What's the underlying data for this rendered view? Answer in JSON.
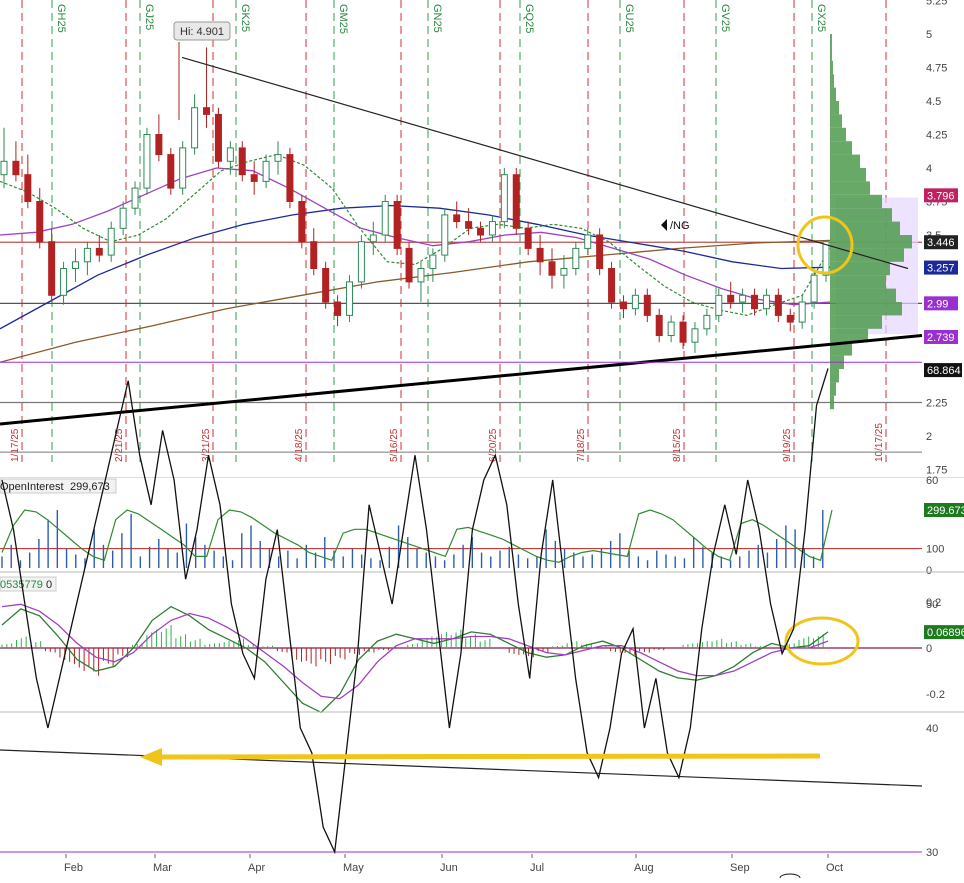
{
  "chart_data": [
    {
      "type": "candlestick",
      "symbol": "/NG",
      "hi_label": "Hi: 4.901",
      "y_ticks": [
        "5.25",
        "5",
        "4.75",
        "4.5",
        "4.25",
        "4",
        "3.75",
        "3.5",
        "3.25",
        "3",
        "2.75",
        "2.5",
        "2.25",
        "2",
        "1.75"
      ],
      "y_tick_values": [
        5.25,
        5,
        4.75,
        4.5,
        4.25,
        4,
        3.75,
        3.5,
        3.25,
        3,
        2.75,
        2.5,
        2.25,
        2,
        1.75
      ],
      "ylim": [
        1.75,
        5.25
      ],
      "price_badges": [
        {
          "label": "3.796",
          "value": 3.796,
          "color": "#c02060"
        },
        {
          "label": "3.446",
          "value": 3.446,
          "color": "#222222"
        },
        {
          "label": "3.257",
          "value": 3.257,
          "color": "#1a2a9a"
        },
        {
          "label": "2.99",
          "value": 2.99,
          "color": "#9b30d0"
        },
        {
          "label": "2.739",
          "value": 2.739,
          "color": "#9b30d0"
        }
      ],
      "contract_labels": [
        "GH25",
        "GJ25",
        "GK25",
        "GM25",
        "GN25",
        "GQ25",
        "GU25",
        "GV25",
        "GX25"
      ],
      "expiry_labels": [
        "1/17/25",
        "2/21/25",
        "3/21/25",
        "4/18/25",
        "5/16/25",
        "6/20/25",
        "7/18/25",
        "8/15/25",
        "9/19/25",
        "10/17/25"
      ],
      "candles": [
        [
          3.95,
          4.3,
          3.85,
          4.05
        ],
        [
          4.05,
          4.2,
          3.9,
          3.95
        ],
        [
          3.95,
          4.1,
          3.7,
          3.75
        ],
        [
          3.75,
          3.85,
          3.4,
          3.45
        ],
        [
          3.45,
          3.55,
          3.0,
          3.05
        ],
        [
          3.05,
          3.3,
          2.98,
          3.25
        ],
        [
          3.25,
          3.4,
          3.15,
          3.3
        ],
        [
          3.3,
          3.45,
          3.2,
          3.4
        ],
        [
          3.4,
          3.5,
          3.3,
          3.35
        ],
        [
          3.35,
          3.6,
          3.3,
          3.55
        ],
        [
          3.55,
          3.75,
          3.5,
          3.7
        ],
        [
          3.7,
          3.9,
          3.65,
          3.85
        ],
        [
          3.85,
          4.3,
          3.8,
          4.25
        ],
        [
          4.25,
          4.4,
          4.05,
          4.1
        ],
        [
          4.1,
          4.15,
          3.8,
          3.85
        ],
        [
          3.85,
          4.2,
          3.8,
          4.15
        ],
        [
          4.15,
          4.55,
          4.1,
          4.45
        ],
        [
          4.45,
          4.9,
          4.3,
          4.4
        ],
        [
          4.4,
          4.45,
          4.0,
          4.05
        ],
        [
          4.05,
          4.2,
          3.95,
          4.15
        ],
        [
          4.15,
          4.2,
          3.9,
          3.95
        ],
        [
          3.95,
          4.05,
          3.8,
          3.9
        ],
        [
          3.9,
          4.1,
          3.85,
          4.05
        ],
        [
          4.05,
          4.2,
          3.95,
          4.1
        ],
        [
          4.1,
          4.15,
          3.7,
          3.75
        ],
        [
          3.75,
          3.8,
          3.4,
          3.45
        ],
        [
          3.45,
          3.55,
          3.2,
          3.25
        ],
        [
          3.25,
          3.3,
          2.95,
          3.0
        ],
        [
          3.0,
          3.05,
          2.82,
          2.9
        ],
        [
          2.9,
          3.2,
          2.85,
          3.15
        ],
        [
          3.15,
          3.5,
          3.1,
          3.45
        ],
        [
          3.45,
          3.6,
          3.35,
          3.5
        ],
        [
          3.5,
          3.8,
          3.45,
          3.75
        ],
        [
          3.75,
          3.8,
          3.35,
          3.4
        ],
        [
          3.4,
          3.45,
          3.1,
          3.15
        ],
        [
          3.15,
          3.3,
          3.0,
          3.25
        ],
        [
          3.25,
          3.4,
          3.15,
          3.35
        ],
        [
          3.35,
          3.7,
          3.3,
          3.65
        ],
        [
          3.65,
          3.75,
          3.55,
          3.6
        ],
        [
          3.6,
          3.7,
          3.5,
          3.55
        ],
        [
          3.55,
          3.6,
          3.45,
          3.5
        ],
        [
          3.5,
          3.65,
          3.45,
          3.6
        ],
        [
          3.6,
          4.0,
          3.55,
          3.95
        ],
        [
          3.95,
          4.0,
          3.5,
          3.55
        ],
        [
          3.55,
          3.6,
          3.35,
          3.4
        ],
        [
          3.4,
          3.5,
          3.2,
          3.3
        ],
        [
          3.3,
          3.4,
          3.1,
          3.2
        ],
        [
          3.2,
          3.35,
          3.1,
          3.25
        ],
        [
          3.25,
          3.45,
          3.2,
          3.4
        ],
        [
          3.4,
          3.55,
          3.35,
          3.5
        ],
        [
          3.5,
          3.55,
          3.2,
          3.25
        ],
        [
          3.25,
          3.3,
          2.95,
          3.0
        ],
        [
          3.0,
          3.05,
          2.88,
          2.95
        ],
        [
          2.95,
          3.1,
          2.9,
          3.05
        ],
        [
          3.05,
          3.1,
          2.85,
          2.9
        ],
        [
          2.9,
          2.95,
          2.7,
          2.75
        ],
        [
          2.75,
          2.9,
          2.7,
          2.85
        ],
        [
          2.85,
          2.9,
          2.65,
          2.7
        ],
        [
          2.7,
          2.85,
          2.62,
          2.8
        ],
        [
          2.8,
          2.95,
          2.75,
          2.9
        ],
        [
          2.9,
          3.1,
          2.85,
          3.05
        ],
        [
          3.05,
          3.15,
          2.95,
          3.0
        ],
        [
          3.0,
          3.1,
          2.92,
          3.05
        ],
        [
          3.05,
          3.1,
          2.9,
          2.95
        ],
        [
          2.95,
          3.1,
          2.9,
          3.05
        ],
        [
          3.05,
          3.1,
          2.85,
          2.9
        ],
        [
          2.9,
          2.95,
          2.78,
          2.85
        ],
        [
          2.85,
          3.05,
          2.8,
          3.0
        ],
        [
          3.0,
          3.25,
          2.95,
          3.2
        ],
        [
          3.2,
          3.46,
          3.15,
          3.45
        ]
      ],
      "ma_green": [
        3.9,
        3.82,
        3.7,
        3.55,
        3.45,
        3.5,
        3.62,
        3.8,
        3.98,
        4.05,
        4.1,
        4.02,
        3.85,
        3.55,
        3.3,
        3.28,
        3.4,
        3.55,
        3.58,
        3.55,
        3.58,
        3.55,
        3.45,
        3.28,
        3.12,
        3.0,
        2.94,
        2.9,
        2.98,
        3.05,
        3.4
      ],
      "ma_purple": [
        3.5,
        3.52,
        3.58,
        3.68,
        3.8,
        3.92,
        4.0,
        3.98,
        3.85,
        3.7,
        3.55,
        3.48,
        3.42,
        3.45,
        3.5,
        3.52,
        3.48,
        3.4,
        3.32,
        3.2,
        3.1,
        3.02,
        2.98,
        3.0
      ],
      "ma_blue": [
        2.8,
        3.0,
        3.2,
        3.35,
        3.48,
        3.58,
        3.65,
        3.7,
        3.72,
        3.7,
        3.65,
        3.58,
        3.5,
        3.44,
        3.38,
        3.3,
        3.25,
        3.26
      ],
      "ma_brown": [
        2.55,
        2.7,
        2.82,
        2.95,
        3.05,
        3.15,
        3.22,
        3.3,
        3.35,
        3.4,
        3.44,
        3.46
      ],
      "volume_profile": [
        {
          "price": 4.95,
          "w": 2
        },
        {
          "price": 4.85,
          "w": 2
        },
        {
          "price": 4.75,
          "w": 3
        },
        {
          "price": 4.65,
          "w": 4
        },
        {
          "price": 4.55,
          "w": 6
        },
        {
          "price": 4.45,
          "w": 9
        },
        {
          "price": 4.35,
          "w": 12
        },
        {
          "price": 4.25,
          "w": 16
        },
        {
          "price": 4.15,
          "w": 22
        },
        {
          "price": 4.05,
          "w": 30
        },
        {
          "price": 3.95,
          "w": 36
        },
        {
          "price": 3.85,
          "w": 40
        },
        {
          "price": 3.75,
          "w": 52
        },
        {
          "price": 3.65,
          "w": 62
        },
        {
          "price": 3.55,
          "w": 70
        },
        {
          "price": 3.45,
          "w": 82
        },
        {
          "price": 3.35,
          "w": 74
        },
        {
          "price": 3.25,
          "w": 60
        },
        {
          "price": 3.15,
          "w": 56
        },
        {
          "price": 3.05,
          "w": 66
        },
        {
          "price": 2.95,
          "w": 72
        },
        {
          "price": 2.85,
          "w": 52
        },
        {
          "price": 2.75,
          "w": 38
        },
        {
          "price": 2.65,
          "w": 22
        },
        {
          "price": 2.55,
          "w": 14
        },
        {
          "price": 2.45,
          "w": 9
        },
        {
          "price": 2.35,
          "w": 6
        },
        {
          "price": 2.25,
          "w": 4
        }
      ]
    },
    {
      "type": "bar",
      "label": "OpenInterest",
      "value_label": "299,673",
      "badge": "299.673",
      "y_ticks": [
        "100",
        "0"
      ],
      "ylim": [
        0,
        320
      ],
      "values": [
        60,
        120,
        40,
        80,
        150,
        250,
        300,
        100,
        70,
        50,
        200,
        120,
        90,
        180,
        280,
        60,
        110,
        150,
        100,
        80,
        230,
        160,
        120,
        90,
        60,
        40,
        180,
        220,
        140,
        100,
        60,
        90,
        50,
        120,
        80,
        160,
        90,
        60,
        100,
        70,
        50,
        40,
        110,
        220,
        160,
        100,
        80,
        60,
        40,
        70,
        120,
        160,
        80,
        60,
        90,
        110,
        70,
        50,
        60,
        200,
        140,
        100,
        80,
        60,
        70,
        100,
        140,
        180,
        90,
        60,
        40,
        90,
        70,
        60,
        50,
        160,
        110,
        80,
        60,
        40,
        60,
        90,
        120,
        80,
        150,
        220,
        200,
        100,
        60,
        300
      ],
      "line_values": [
        80,
        220,
        300,
        290,
        250,
        200,
        150,
        100,
        60,
        40,
        250,
        300,
        280,
        240,
        200,
        160,
        120,
        60,
        60,
        250,
        300,
        290,
        260,
        220,
        180,
        150,
        120,
        80,
        60,
        40,
        180,
        200,
        200,
        180,
        160,
        140,
        120,
        100,
        80,
        60,
        200,
        210,
        190,
        170,
        150,
        120,
        90,
        60,
        40,
        30,
        60,
        80,
        90,
        80,
        70,
        60,
        280,
        300,
        280,
        250,
        200,
        150,
        100,
        60,
        40,
        230,
        250,
        220,
        180,
        140,
        100,
        60,
        40,
        300
      ]
    },
    {
      "type": "bar",
      "label": "0535779",
      "value_label": "0",
      "badge": "0.06896",
      "y_ticks": [
        "0.2",
        "0",
        "-0.2"
      ],
      "ylim": [
        -0.3,
        0.22
      ],
      "values": [
        0.02,
        0.05,
        0.03,
        -0.02,
        -0.06,
        -0.1,
        -0.12,
        -0.08,
        -0.04,
        0.02,
        0.08,
        0.1,
        0.06,
        0.04,
        0.02,
        0.03,
        0.04,
        0.02,
        0.01,
        -0.02,
        -0.06,
        -0.08,
        -0.07,
        -0.05,
        -0.03,
        -0.02,
        -0.01,
        0.0,
        0.02,
        0.05,
        0.07,
        0.08,
        0.06,
        0.04,
        0.0,
        -0.03,
        -0.04,
        -0.02,
        0.01,
        0.03,
        0.02,
        0.01,
        -0.02,
        -0.03,
        -0.02,
        -0.01,
        0.0,
        0.02,
        0.03,
        0.04,
        0.03,
        0.02,
        0.01,
        0.0,
        0.02,
        0.05,
        0.06
      ],
      "macd": [
        0.1,
        0.17,
        0.14,
        0.05,
        -0.05,
        -0.1,
        -0.08,
        0.0,
        0.12,
        0.18,
        0.14,
        0.08,
        0.04,
        0.0,
        -0.06,
        -0.15,
        -0.24,
        -0.28,
        -0.2,
        -0.05,
        0.03,
        0.06,
        0.04,
        0.02,
        0.04,
        0.07,
        0.06,
        0.02,
        -0.02,
        -0.04,
        -0.03,
        0.01,
        0.03,
        0.0,
        -0.05,
        -0.1,
        -0.13,
        -0.14,
        -0.12,
        -0.08,
        -0.02,
        0.02,
        0.0,
        0.01,
        0.07
      ],
      "signal": [
        0.18,
        0.19,
        0.16,
        0.1,
        0.02,
        -0.04,
        -0.06,
        -0.02,
        0.06,
        0.12,
        0.15,
        0.13,
        0.09,
        0.04,
        -0.02,
        -0.08,
        -0.15,
        -0.21,
        -0.22,
        -0.16,
        -0.06,
        0.01,
        0.04,
        0.04,
        0.04,
        0.05,
        0.05,
        0.04,
        0.01,
        -0.02,
        -0.03,
        -0.01,
        0.01,
        0.01,
        -0.02,
        -0.06,
        -0.1,
        -0.12,
        -0.12,
        -0.1,
        -0.06,
        -0.02,
        0.0,
        0.0,
        0.03
      ]
    },
    {
      "type": "line",
      "badge": "68.864",
      "y_ticks": [
        "60",
        "50",
        "40",
        "30"
      ],
      "ylim": [
        28,
        72
      ],
      "values": [
        60,
        56,
        50,
        44,
        40,
        44,
        48,
        52,
        56,
        60,
        64,
        68,
        62,
        58,
        64,
        60,
        52,
        56,
        62,
        58,
        50,
        46,
        44,
        52,
        56,
        48,
        40,
        38,
        32,
        30,
        38,
        46,
        58,
        54,
        50,
        56,
        62,
        56,
        48,
        40,
        46,
        56,
        60,
        62,
        58,
        50,
        44,
        54,
        60,
        52,
        44,
        38,
        36,
        40,
        46,
        48,
        40,
        44,
        38,
        36,
        40,
        48,
        54,
        58,
        54,
        60,
        56,
        50,
        46,
        48,
        56,
        66,
        69
      ]
    }
  ],
  "x_axis_labels": [
    "Feb",
    "Mar",
    "Apr",
    "May",
    "Jun",
    "Jul",
    "Aug",
    "Sep",
    "Oct"
  ]
}
